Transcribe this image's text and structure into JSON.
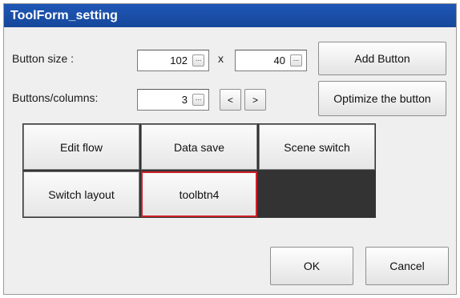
{
  "window": {
    "title": "ToolForm_setting"
  },
  "button_size": {
    "label": "Button size :",
    "width": "102",
    "separator": "x",
    "height": "40",
    "ellipsis": "..."
  },
  "columns": {
    "label": "Buttons/columns:",
    "value": "3",
    "ellipsis": "...",
    "prev_label": "<",
    "next_label": ">"
  },
  "actions": {
    "add_button": "Add Button",
    "optimize_button": "Optimize the button"
  },
  "tool_buttons": [
    "Edit flow",
    "Data save",
    "Scene switch",
    "Switch layout",
    "toolbtn4"
  ],
  "selected_tool_button": "toolbtn4",
  "footer": {
    "ok": "OK",
    "cancel": "Cancel"
  },
  "colors": {
    "title_bar": "#1a4ea6",
    "selection_border": "#d0202a",
    "grid_background": "#333333"
  }
}
